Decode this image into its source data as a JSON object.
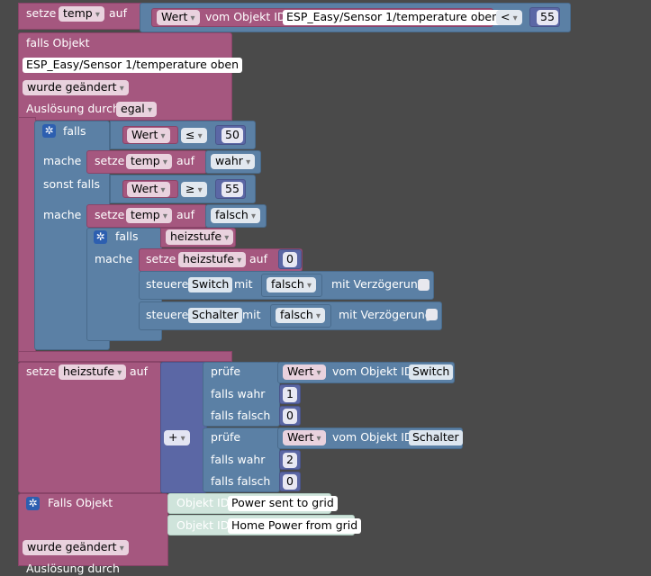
{
  "block_set_temp_top": {
    "setze": "setze",
    "var": "temp",
    "auf": "auf",
    "wert": "Wert",
    "vom_objekt": "vom Objekt ID",
    "objekt": "ESP_Easy/Sensor 1/temperature oben",
    "op": "<",
    "num": "55"
  },
  "trigger1": {
    "falls_objekt": "falls Objekt",
    "objekt": "ESP_Easy/Sensor 1/temperature oben",
    "wurde": "wurde geändert",
    "ausloesung": "Auslösung durch",
    "egal": "egal"
  },
  "if1": {
    "falls": "falls",
    "wert1": "Wert",
    "op1": "≤",
    "num1": "50",
    "mache1": "mache",
    "setze1": "setze",
    "var1": "temp",
    "auf1": "auf",
    "val1": "wahr",
    "sonst_falls": "sonst falls",
    "wert2": "Wert",
    "op2": "≥",
    "num2": "55",
    "mache2": "mache",
    "setze2": "setze",
    "var2": "temp",
    "auf2": "auf",
    "val2": "falsch"
  },
  "if2": {
    "falls": "falls",
    "var": "heizstufe",
    "mache": "mache",
    "setze": "setze",
    "var2": "heizstufe",
    "auf": "auf",
    "num": "0"
  },
  "steuere1": {
    "steuere": "steuere",
    "obj": "Switch",
    "mit": "mit",
    "val": "falsch",
    "verz": "mit Verzögerung"
  },
  "steuere2": {
    "steuere": "steuere",
    "obj": "Schalter",
    "mit": "mit",
    "val": "falsch",
    "verz": "mit Verzögerung"
  },
  "set_heizstufe": {
    "setze": "setze",
    "var": "heizstufe",
    "auf": "auf",
    "plus": "+"
  },
  "pruefe1": {
    "pruefe": "prüfe",
    "wert": "Wert",
    "vom": "vom Objekt ID",
    "obj": "Switch",
    "fw": "falls wahr",
    "fw_val": "1",
    "ff": "falls falsch",
    "ff_val": "0"
  },
  "pruefe2": {
    "pruefe": "prüfe",
    "wert": "Wert",
    "vom": "vom Objekt ID",
    "obj": "Schalter",
    "fw": "falls wahr",
    "fw_val": "2",
    "ff": "falls falsch",
    "ff_val": "0"
  },
  "trigger2": {
    "falls_objekt": "Falls Objekt",
    "objid1": "Objekt ID",
    "obj1": "Power sent to grid",
    "objid2": "Objekt ID",
    "obj2": "Home Power from grid",
    "wurde": "wurde geändert",
    "ausloesung": "Auslösung durch"
  },
  "colors": {
    "background": "#4a4a4a",
    "trigger": "#a5577f",
    "logic": "#5b80a5",
    "math": "#5b67a5",
    "object": "#cfe4db"
  }
}
